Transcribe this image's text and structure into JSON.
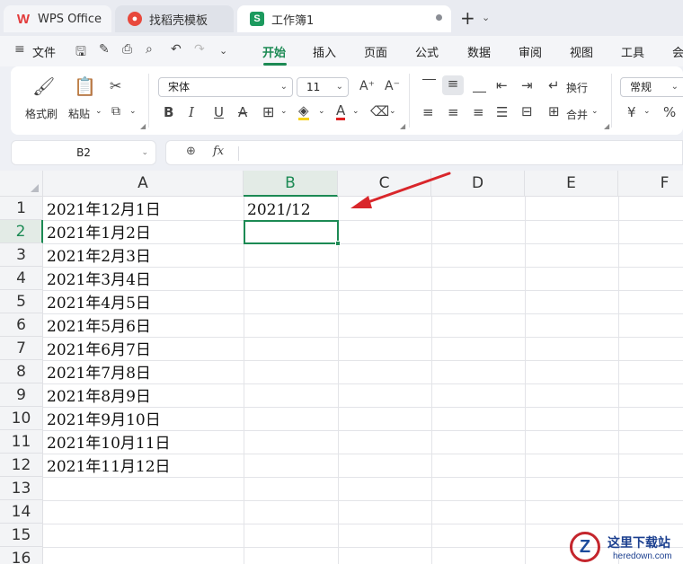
{
  "tabs": [
    {
      "label": "WPS Office",
      "icon": "wps-logo-icon"
    },
    {
      "label": "找稻壳模板",
      "icon": "daoke-icon"
    },
    {
      "label": "工作簿1",
      "icon": "spreadsheet-icon",
      "icon_letter": "S"
    }
  ],
  "menu": {
    "file": "文件",
    "items": [
      "开始",
      "插入",
      "页面",
      "公式",
      "数据",
      "审阅",
      "视图",
      "工具",
      "会"
    ],
    "active": "开始"
  },
  "ribbon": {
    "format_painter": "格式刷",
    "paste": "粘贴",
    "font_name": "宋体",
    "font_size": "11",
    "bold": "B",
    "italic": "I",
    "underline": "U",
    "strike": "A",
    "wrap_text": "换行",
    "merge": "合并",
    "number_format": "常规",
    "currency": "¥",
    "percent": "%"
  },
  "formula_bar": {
    "name_box": "B2",
    "fx": "fx",
    "content": ""
  },
  "sheet": {
    "columns": [
      "A",
      "B",
      "C",
      "D",
      "E",
      "F"
    ],
    "selected_column": "B",
    "rows": [
      "1",
      "2",
      "3",
      "4",
      "5",
      "6",
      "7",
      "8",
      "9",
      "10",
      "11",
      "12",
      "13",
      "14",
      "15",
      "16"
    ],
    "selected_row": "2",
    "column_a": [
      "2021年12月1日",
      "2021年1月2日",
      "2021年2月3日",
      "2021年3月4日",
      "2021年4月5日",
      "2021年5月6日",
      "2021年6月7日",
      "2021年7月8日",
      "2021年8月9日",
      "2021年9月10日",
      "2021年10月11日",
      "2021年11月12日"
    ],
    "b1": "2021/12"
  },
  "annotation": {
    "arrow_color": "#d9262b"
  },
  "watermark": {
    "title": "这里下载站",
    "url": "heredown.com",
    "letter": "Z"
  },
  "colors": {
    "accent": "#1c8a54",
    "wps_red": "#e23a3a"
  }
}
